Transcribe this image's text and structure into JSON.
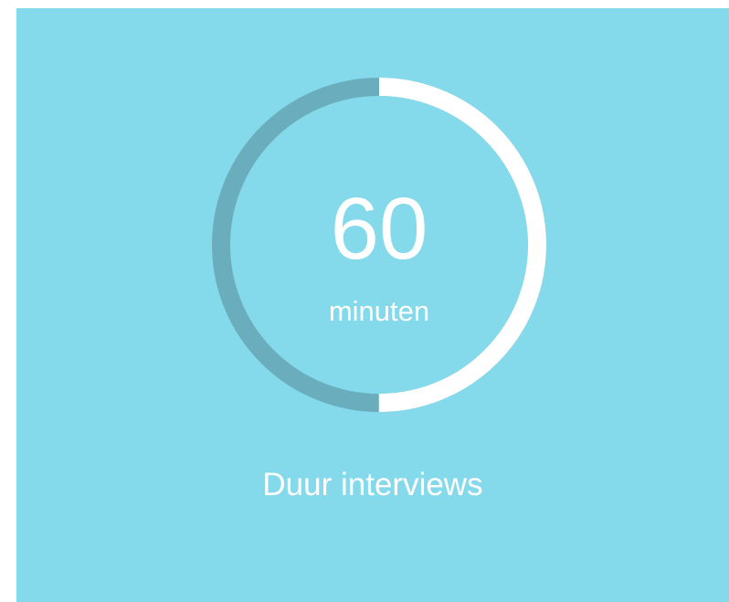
{
  "stat": {
    "value": "60",
    "unit": "minuten",
    "caption": "Duur interviews",
    "fill_fraction": 0.5
  },
  "colors": {
    "background": "#84d9eb",
    "track": "#6aaebe",
    "progress": "#ffffff",
    "text": "#ffffff"
  }
}
